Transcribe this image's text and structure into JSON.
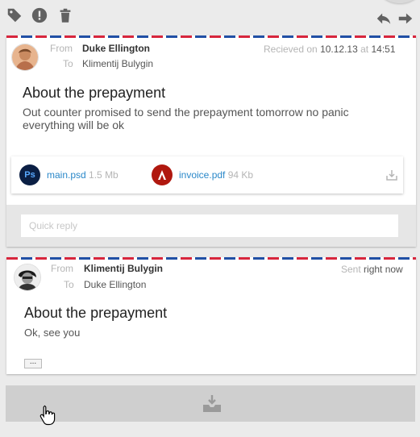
{
  "toolbar": {
    "left_icons": [
      "tag-icon",
      "report-icon",
      "trash-icon"
    ],
    "right_icons": [
      "reply-icon",
      "forward-icon"
    ]
  },
  "messages": [
    {
      "from_label": "From",
      "to_label": "To",
      "from": "Duke Ellington",
      "to": "Klimentij Bulygin",
      "date_prefix": "Recieved on",
      "date": "10.12.13",
      "date_at": "at",
      "time": "14:51",
      "subject": "About the prepayment",
      "body": "Out counter promised to send the prepayment tomorrow no panic everything will be ok",
      "attachments": [
        {
          "icon_text": "Ps",
          "name": "main.psd",
          "size": "1.5 Mb",
          "color": "#0b1f44"
        },
        {
          "icon_text": "",
          "name": "invoice.pdf",
          "size": "94 Kb",
          "color": "#b0180f"
        }
      ],
      "quick_reply_placeholder": "Quick reply"
    },
    {
      "from_label": "From",
      "to_label": "To",
      "from": "Klimentij Bulygin",
      "to": "Duke Ellington",
      "status_prefix": "Sent",
      "status": "right now",
      "subject": "About the prepayment",
      "body": "Ok, see you",
      "more_label": "..."
    }
  ],
  "colors": {
    "airmail_red": "#d7263d",
    "airmail_blue": "#2150a5",
    "link": "#2a88c9"
  }
}
